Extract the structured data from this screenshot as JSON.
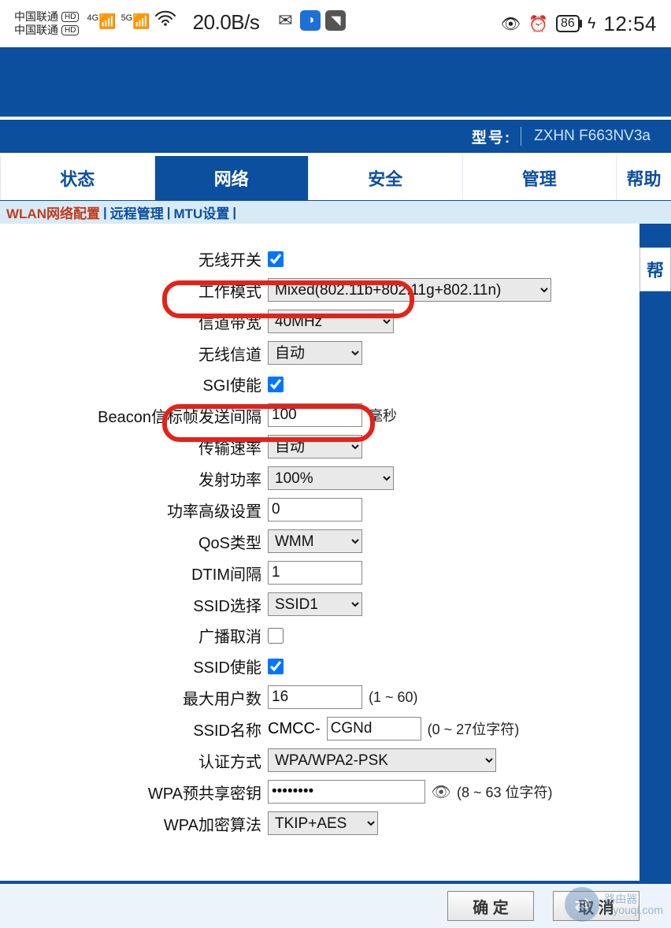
{
  "status_bar": {
    "carrier": "中国联通",
    "hd_badge": "HD",
    "speed": "20.0B/s",
    "battery_pct": "86",
    "time": "12:54"
  },
  "model_bar": {
    "label": "型号:",
    "value": "ZXHN F663NV3a"
  },
  "main_tabs": [
    "状态",
    "网络",
    "安全",
    "管理",
    "帮助"
  ],
  "main_tab_active_index": 1,
  "sub_tabs": [
    "WLAN网络配置",
    "远程管理",
    "MTU设置"
  ],
  "sub_tab_active_index": 0,
  "help_tab_label": "帮",
  "form": {
    "wireless_switch": {
      "label": "无线开关",
      "checked": true
    },
    "work_mode": {
      "label": "工作模式",
      "value": "Mixed(802.11b+802.11g+802.11n)"
    },
    "channel_bw": {
      "label": "信道带宽",
      "value": "40MHz"
    },
    "wireless_channel": {
      "label": "无线信道",
      "value": "自动"
    },
    "sgi_enable": {
      "label": "SGI使能",
      "checked": true
    },
    "beacon_interval": {
      "label": "Beacon信标帧发送间隔",
      "value": "100",
      "unit": "毫秒"
    },
    "tx_rate": {
      "label": "传输速率",
      "value": "自动"
    },
    "tx_power": {
      "label": "发射功率",
      "value": "100%"
    },
    "power_adv": {
      "label": "功率高级设置",
      "value": "0"
    },
    "qos_type": {
      "label": "QoS类型",
      "value": "WMM"
    },
    "dtim": {
      "label": "DTIM间隔",
      "value": "1"
    },
    "ssid_select": {
      "label": "SSID选择",
      "value": "SSID1"
    },
    "broadcast_cancel": {
      "label": "广播取消",
      "checked": false
    },
    "ssid_enable": {
      "label": "SSID使能",
      "checked": true
    },
    "max_users": {
      "label": "最大用户数",
      "value": "16",
      "hint": "(1 ~ 60)"
    },
    "ssid_name": {
      "label": "SSID名称",
      "prefix": "CMCC-",
      "value": "CGNd",
      "hint": "(0 ~ 27位字符)"
    },
    "auth_method": {
      "label": "认证方式",
      "value": "WPA/WPA2-PSK"
    },
    "wpa_psk": {
      "label": "WPA预共享密钥",
      "value": "••••••••",
      "hint": "(8 ~ 63 位字符)"
    },
    "wpa_algo": {
      "label": "WPA加密算法",
      "value": "TKIP+AES"
    }
  },
  "footer": {
    "ok": "确 定",
    "cancel": "取 消"
  },
  "watermark": {
    "brand": "路由器",
    "url": "luyouqi.com"
  }
}
